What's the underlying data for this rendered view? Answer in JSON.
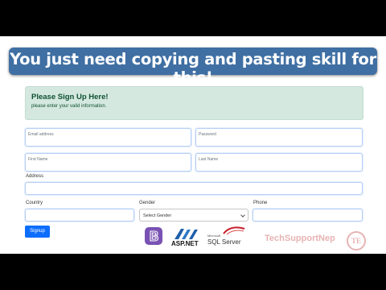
{
  "banner": {
    "text": "You just need copying and pasting skill for this!"
  },
  "alert": {
    "title": "Please Sign Up Here!",
    "subtitle": "please enter your valid information."
  },
  "form": {
    "email_placeholder": "Email address",
    "password_placeholder": "Password",
    "first_name_placeholder": "First Name",
    "last_name_placeholder": "Last Name",
    "address_label": "Address",
    "country_label": "Country",
    "gender_label": "Gender",
    "gender_selected": "Select Gender",
    "phone_label": "Phone",
    "signup_label": "Signup"
  },
  "logos": {
    "asp": "ASP.NET",
    "sql_ms": "Microsoft",
    "sql": "SQL Server",
    "brand": "TechSupportNep",
    "brand_mark": "TE"
  },
  "colors": {
    "primary": "#0d6efd",
    "alert_bg": "#d4e8df",
    "banner_bg": "#3f6fa3",
    "brand": "#e7b3b3"
  }
}
